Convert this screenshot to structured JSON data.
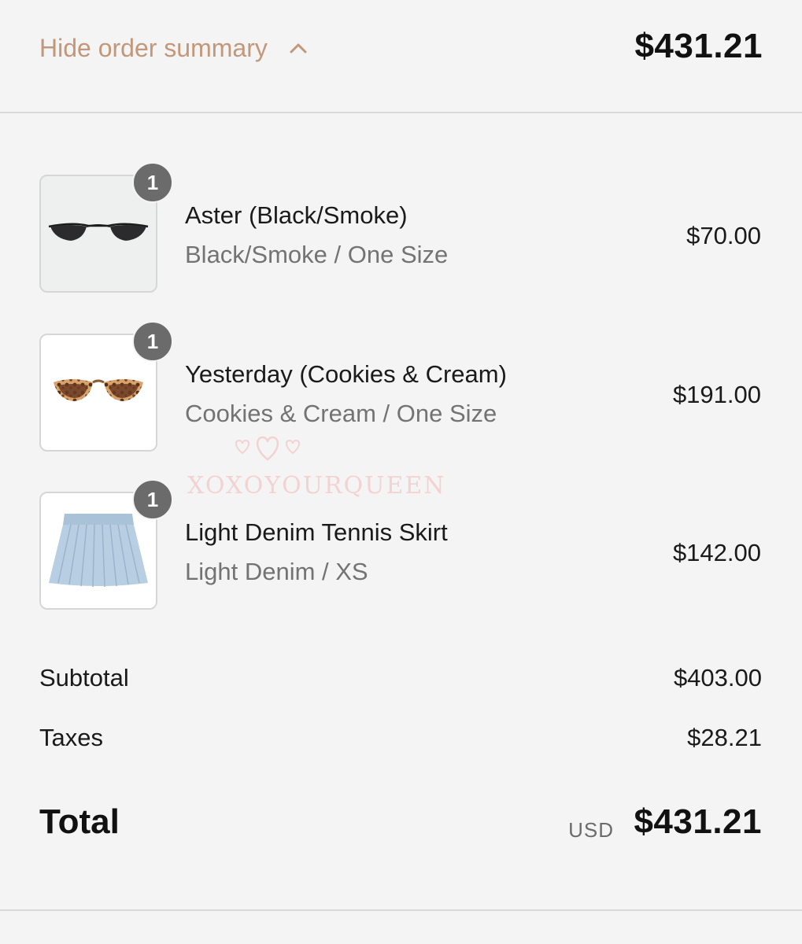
{
  "summary_toggle": {
    "label": "Hide order summary",
    "total": "$431.21"
  },
  "line_items": [
    {
      "quantity": "1",
      "name": "Aster (Black/Smoke)",
      "variant": "Black/Smoke / One Size",
      "price": "$70.00",
      "image_icon": "sunglasses-black-icon"
    },
    {
      "quantity": "1",
      "name": "Yesterday (Cookies & Cream)",
      "variant": "Cookies & Cream / One Size",
      "price": "$191.00",
      "image_icon": "sunglasses-tortoise-icon"
    },
    {
      "quantity": "1",
      "name": "Light Denim Tennis Skirt",
      "variant": "Light Denim / XS",
      "price": "$142.00",
      "image_icon": "pleated-skirt-icon"
    }
  ],
  "costs": {
    "subtotal_label": "Subtotal",
    "subtotal_value": "$403.00",
    "taxes_label": "Taxes",
    "taxes_value": "$28.21"
  },
  "total": {
    "label": "Total",
    "currency": "USD",
    "value": "$431.21"
  },
  "watermark": {
    "text": "XOXOYOURQUEEN"
  },
  "colors": {
    "accent": "#c2977a",
    "badge": "#6b6b6b",
    "background": "#f4f4f4",
    "watermark": "#f3d2d2"
  }
}
